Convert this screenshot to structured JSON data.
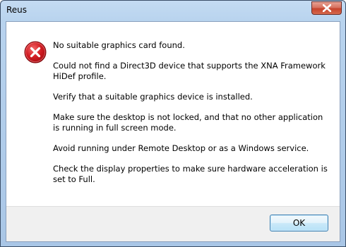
{
  "window": {
    "title": "Reus"
  },
  "icon": {
    "type": "error-icon",
    "colors": {
      "fill": "#c8141a",
      "border": "#7e0a0e",
      "glyph": "#ffffff"
    }
  },
  "messages": [
    "No suitable graphics card found.",
    "Could not find a Direct3D device that supports the XNA Framework HiDef profile.",
    "Verify that a suitable graphics device is installed.",
    "Make sure the desktop is not locked, and that no other application is running in full screen mode.",
    "Avoid running under Remote Desktop or as a Windows service.",
    "Check the display properties to make sure hardware acceleration is set to Full."
  ],
  "buttons": {
    "ok_label": "OK"
  }
}
